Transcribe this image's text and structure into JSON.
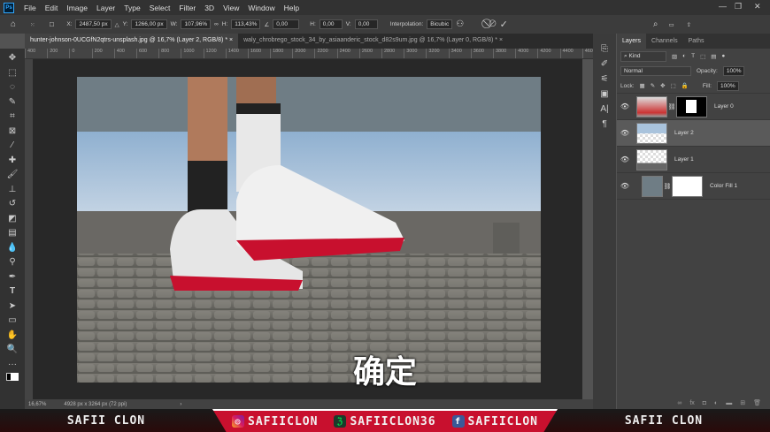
{
  "menubar": {
    "app_icon": "Ps",
    "items": [
      "File",
      "Edit",
      "Image",
      "Layer",
      "Type",
      "Select",
      "Filter",
      "3D",
      "View",
      "Window",
      "Help"
    ]
  },
  "options": {
    "x_label": "X:",
    "x": "2487,50 px",
    "y_label": "Y:",
    "y": "1266,00 px",
    "w_label": "W:",
    "w": "107,96%",
    "h_label": "H:",
    "h": "113,43%",
    "angle": "0,00",
    "hskew_label": "H:",
    "hskew": "0,00",
    "vskew_label": "V:",
    "vskew": "0,00",
    "interp_label": "Interpolation:",
    "interp": "Bicubic"
  },
  "tabs": [
    {
      "label": "hunter-johnson-0UCGfN2qtrs-unsplash.jpg @ 16,7% (Layer 2, RGB/8) *",
      "active": true
    },
    {
      "label": "waly_chrobrego_stock_34_by_asiaanderic_stock_d82s9um.jpg @ 16,7% (Layer 0, RGB/8) *",
      "active": false
    }
  ],
  "ruler": [
    "400",
    "200",
    "0",
    "200",
    "400",
    "600",
    "800",
    "1000",
    "1200",
    "1400",
    "1600",
    "1800",
    "2000",
    "2200",
    "2400",
    "2600",
    "2800",
    "3000",
    "3200",
    "3400",
    "3600",
    "3800",
    "4000",
    "4200",
    "4400",
    "4600",
    "4800",
    "5000",
    "5200"
  ],
  "status": {
    "zoom": "16,67%",
    "size": "4928 px x 3264 px (72 ppi)",
    "arrow": "›"
  },
  "subtitle": "确定",
  "layers_panel": {
    "tabs": [
      "Layers",
      "Channels",
      "Paths"
    ],
    "filter_placeholder": "Kind",
    "blend_mode": "Normal",
    "opacity_label": "Opacity:",
    "opacity": "100%",
    "lock_label": "Lock:",
    "fill_label": "Fill:",
    "fill": "100%",
    "layers": [
      {
        "name": "Layer 0",
        "selected": false,
        "mask": true
      },
      {
        "name": "Layer 2",
        "selected": true,
        "mask": false
      },
      {
        "name": "Layer 1",
        "selected": false,
        "mask": false
      },
      {
        "name": "Color Fill 1",
        "selected": false,
        "mask": true
      }
    ]
  },
  "banner": {
    "left": "SAFII CLON",
    "instagram": "SAFIICLON",
    "deviantart": "SAFIICLON36",
    "facebook": "SAFIICLON",
    "right": "SAFII CLON"
  },
  "colors": {
    "accent_red": "#c8102e",
    "fill_color": "#6f7d85"
  }
}
